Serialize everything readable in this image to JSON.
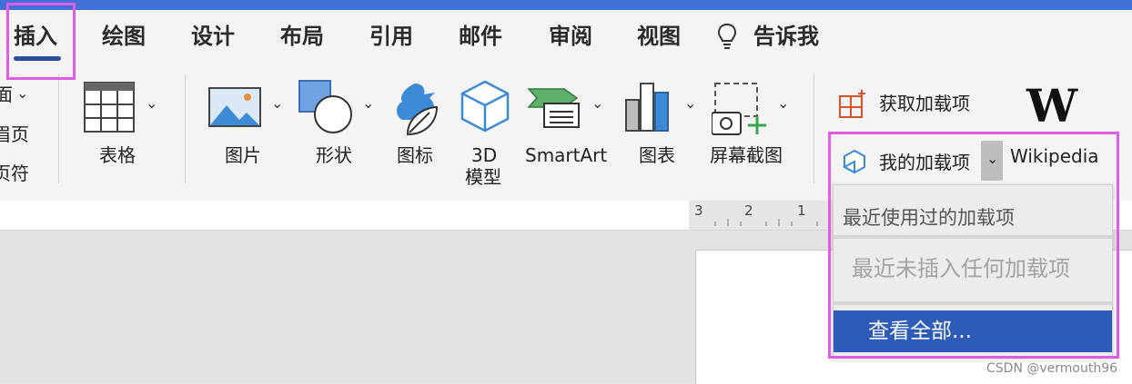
{
  "tabs": [
    "插入",
    "绘图",
    "设计",
    "布局",
    "引用",
    "邮件",
    "审阅",
    "视图"
  ],
  "tell_me": "告诉我",
  "left_partial": {
    "line1": "面",
    "line2": "眉页",
    "line3": "页符"
  },
  "ribbon": {
    "table": "表格",
    "picture": "图片",
    "shapes": "形状",
    "icons": "图标",
    "model3d_line1": "3D",
    "model3d_line2": "模型",
    "smartart": "SmartArt",
    "chart": "图表",
    "screenshot": "屏幕截图",
    "get_addins": "获取加载项",
    "my_addins": "我的加载项",
    "wikipedia": "Wikipedia",
    "wikipedia_logo": "W"
  },
  "ruler": {
    "marks": [
      "3",
      "2",
      "1"
    ]
  },
  "dropdown": {
    "title": "最近使用过的加载项",
    "empty": "最近未插入任何加载项",
    "view_all": "查看全部..."
  },
  "watermark": "CSDN @vermouth96",
  "colors": {
    "highlight": "#e05ce6",
    "accent": "#2d5cb8",
    "tab_underline": "#2b4fa0",
    "topbar": "#3f71d6"
  }
}
